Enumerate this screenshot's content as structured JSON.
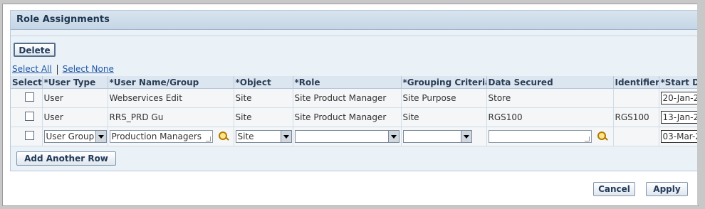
{
  "region": {
    "title": "Role Assignments"
  },
  "toolbar": {
    "delete_label": "Delete"
  },
  "selection": {
    "select_all": "Select All",
    "select_none": "Select None"
  },
  "columns": [
    {
      "label": "Select",
      "required": ""
    },
    {
      "label": "User Type",
      "required": "*"
    },
    {
      "label": "User Name/Group",
      "required": "*"
    },
    {
      "label": "Object",
      "required": "*"
    },
    {
      "label": "Role",
      "required": "*"
    },
    {
      "label": "Grouping Criteria",
      "required": "*"
    },
    {
      "label": "Data Secured",
      "required": ""
    },
    {
      "label": "Identifier",
      "required": ""
    },
    {
      "label": "Start D",
      "required": "*"
    }
  ],
  "rows": [
    {
      "user_type": "User",
      "user_name": "Webservices Edit",
      "object": "Site",
      "role": "Site Product Manager",
      "grouping": "Site Purpose",
      "data_secured": "Store",
      "identifier": "",
      "start_date": "20-Jan-2"
    },
    {
      "user_type": "User",
      "user_name": "RRS_PRD Gu",
      "object": "Site",
      "role": "Site Product Manager",
      "grouping": "Site",
      "data_secured": "RGS100",
      "identifier": "RGS100",
      "start_date": "13-Jan-2"
    }
  ],
  "new_row": {
    "user_type": "User Group",
    "user_name": "Production Managers",
    "object": "Site",
    "role": "",
    "grouping": "",
    "data_secured": "",
    "identifier": "",
    "start_date": "03-Mar-2"
  },
  "buttons": {
    "add_row": "Add Another Row",
    "cancel": "Cancel",
    "apply": "Apply"
  }
}
